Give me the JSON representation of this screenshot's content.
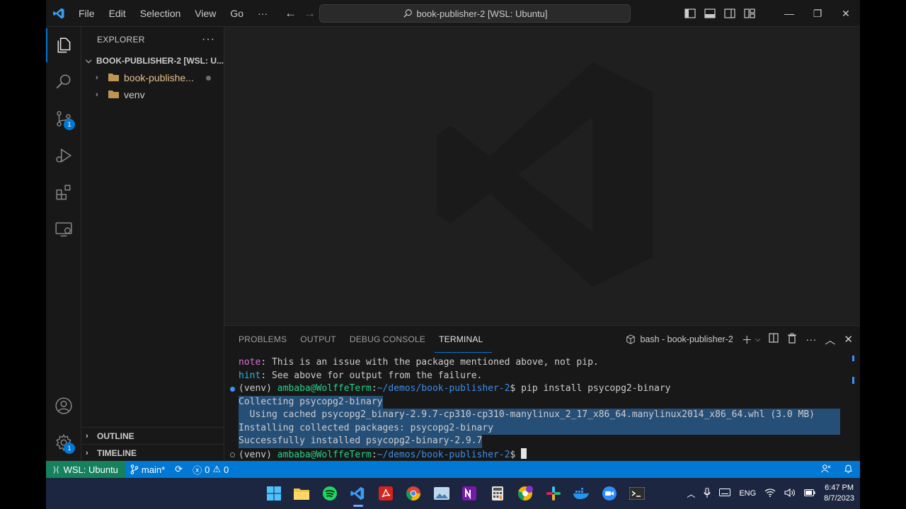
{
  "titlebar": {
    "menu": [
      "File",
      "Edit",
      "Selection",
      "View",
      "Go"
    ],
    "more": "···",
    "search_text": "book-publisher-2 [WSL: Ubuntu]",
    "window_controls": [
      "—",
      "❐",
      "✕"
    ]
  },
  "activity_bar": {
    "items": [
      "explorer",
      "search",
      "source-control",
      "run-debug",
      "extensions",
      "remote-explorer"
    ],
    "scm_badge": "1",
    "settings_badge": "1"
  },
  "sidebar": {
    "title": "EXPLORER",
    "more": "···",
    "root": "BOOK-PUBLISHER-2 [WSL: U...",
    "items": [
      {
        "label": "book-publishe...",
        "modified": true
      },
      {
        "label": "venv",
        "modified": false
      }
    ],
    "sections": [
      "OUTLINE",
      "TIMELINE"
    ]
  },
  "panel": {
    "tabs": [
      "PROBLEMS",
      "OUTPUT",
      "DEBUG CONSOLE",
      "TERMINAL"
    ],
    "active_tab": "TERMINAL",
    "terminal_name": "bash - book-publisher-2"
  },
  "terminal": {
    "line1": {
      "tag": "note",
      "text": ": This is an issue with the package mentioned above, not pip."
    },
    "line2": {
      "tag": "hint",
      "text": ": See above for output from the failure."
    },
    "prompt1": {
      "venv": "(venv) ",
      "user": "ambaba@WolffeTerm",
      "colon": ":",
      "path": "~/demos/book-publisher-2",
      "cmd": "$ pip install psycopg2-binary"
    },
    "out1": "Collecting psycopg2-binary",
    "out2": "  Using cached psycopg2_binary-2.9.7-cp310-cp310-manylinux_2_17_x86_64.manylinux2014_x86_64.whl (3.0 MB)",
    "out3": "Installing collected packages: psycopg2-binary",
    "out4": "Successfully installed psycopg2-binary-2.9.7",
    "prompt2": {
      "venv": "(venv) ",
      "user": "ambaba@WolffeTerm",
      "colon": ":",
      "path": "~/demos/book-publisher-2",
      "cmd": "$ "
    }
  },
  "statusbar": {
    "remote": "WSL: Ubuntu",
    "branch": "main*",
    "errors": "0",
    "warnings": "0"
  },
  "taskbar": {
    "lang": "ENG",
    "time": "6:47 PM",
    "date": "8/7/2023"
  },
  "colors": {
    "accent": "#0078d4",
    "remote": "#16825d",
    "selection": "#264f78"
  }
}
